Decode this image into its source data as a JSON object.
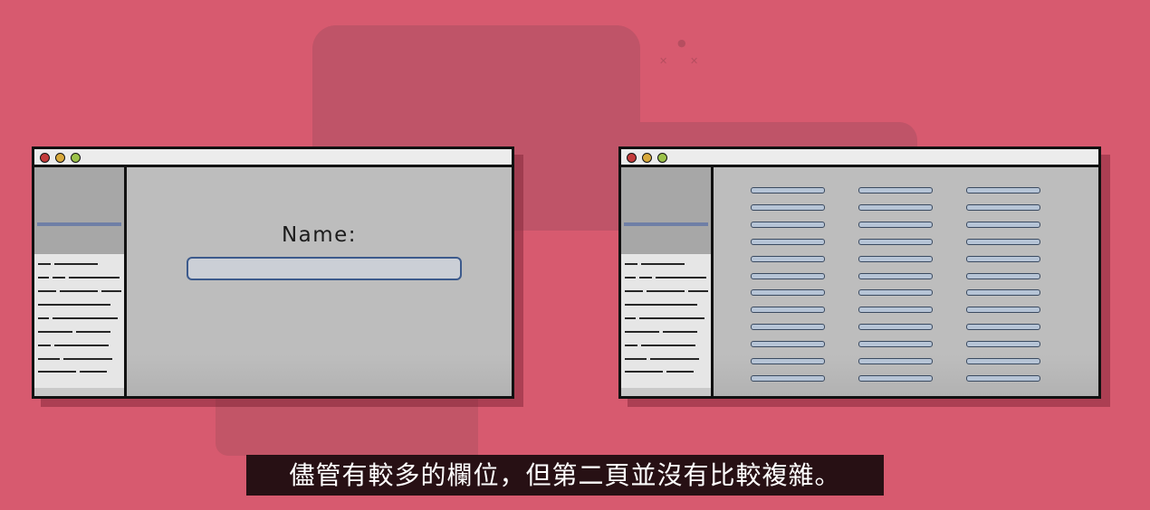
{
  "form_window": {
    "name_label": "Name:",
    "name_value": ""
  },
  "subtitle": "儘管有較多的欄位，但第二頁並沒有比較複雜。",
  "colors": {
    "background": "#d75a6f",
    "window_bg": "#bdbdbd",
    "accent": "#3c5a8c",
    "subtitle_bg": "#000000"
  },
  "icons": [
    "window-close-dot-icon",
    "window-minimize-dot-icon",
    "window-maximize-dot-icon",
    "sparkle-icon"
  ]
}
